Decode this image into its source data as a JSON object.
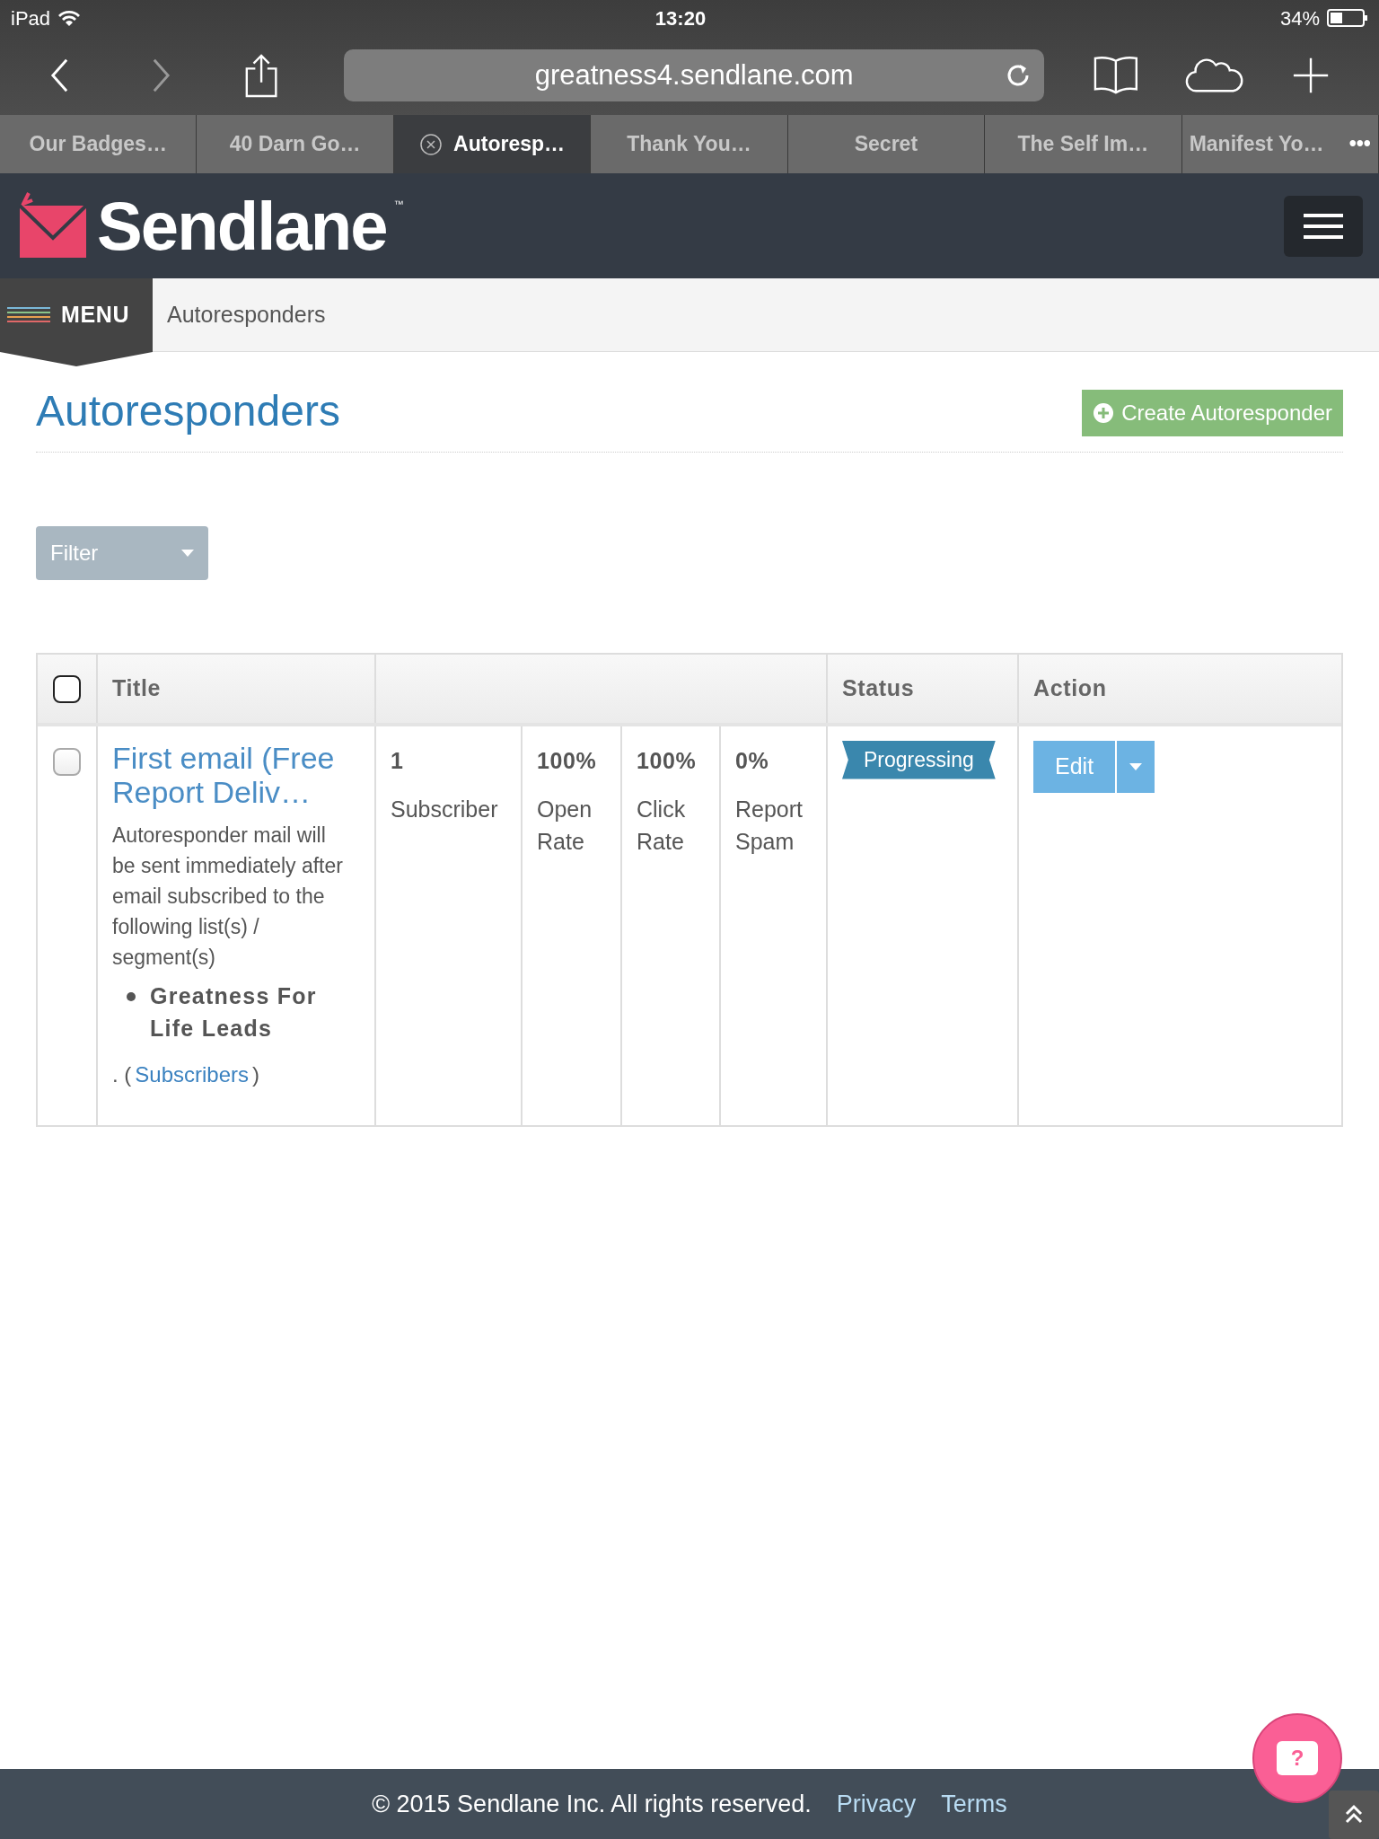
{
  "status_bar": {
    "device": "iPad",
    "time": "13:20",
    "battery": "34%"
  },
  "browser": {
    "url": "greatness4.sendlane.com",
    "tabs": [
      {
        "label": "Our Badges…",
        "selected": false
      },
      {
        "label": "40 Darn Go…",
        "selected": false
      },
      {
        "label": "Autoresp…",
        "selected": true
      },
      {
        "label": "Thank You…",
        "selected": false
      },
      {
        "label": "Secret",
        "selected": false
      },
      {
        "label": "The Self Im…",
        "selected": false
      },
      {
        "label": "Manifest Yo…",
        "selected": false
      }
    ],
    "more": "•••"
  },
  "header": {
    "logo": "Sendlane",
    "trademark": "™"
  },
  "breadcrumb": {
    "menu": "MENU",
    "current": "Autoresponders"
  },
  "page": {
    "title": "Autoresponders",
    "create_button": "Create Autoresponder",
    "filter": "Filter"
  },
  "table": {
    "columns": [
      "Title",
      "",
      "Status",
      "Action"
    ],
    "select_all_checked": false,
    "rows": [
      {
        "checked": false,
        "title": "First email (Free Report Deliv…",
        "description": "Autoresponder mail will be sent immediately after email subscribed to the following list(s) / segment(s)",
        "lists": [
          "Greatness For Life Leads"
        ],
        "subscribers_prefix": ". (",
        "subscribers_link": "Subscribers",
        "subscribers_suffix": ")",
        "stats": [
          {
            "value": "1",
            "label": "Subscriber"
          },
          {
            "value": "100%",
            "label": "Open Rate"
          },
          {
            "value": "100%",
            "label": "Click Rate"
          },
          {
            "value": "0%",
            "label": "Report Spam"
          }
        ],
        "status": "Progressing",
        "action": "Edit"
      }
    ]
  },
  "footer": {
    "copyright": "© 2015 Sendlane Inc. All rights reserved.",
    "links": [
      "Privacy",
      "Terms"
    ]
  },
  "help_button": "?"
}
